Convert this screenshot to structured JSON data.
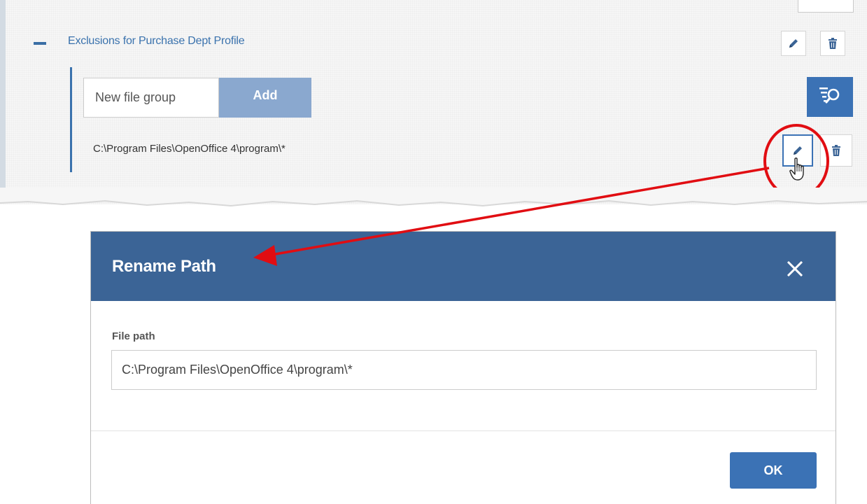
{
  "exclusions": {
    "title": "Exclusions for Purchase Dept Profile",
    "new_file_group_placeholder": "New file group",
    "add_label": "Add",
    "path": "C:\\Program Files\\OpenOffice 4\\program\\*"
  },
  "dialog": {
    "title": "Rename Path",
    "close_symbol": "✕",
    "field_label": "File path",
    "field_value": "C:\\Program Files\\OpenOffice 4\\program\\*",
    "ok_label": "OK"
  },
  "icons": {
    "collapse": "minus-icon",
    "edit": "pencil-icon",
    "delete": "trash-icon",
    "search": "filter-search-icon",
    "cursor": "hand-pointer-icon"
  },
  "colors": {
    "accent": "#3b72b5",
    "link": "#3a72ad",
    "dialog_header": "#3b6496",
    "add_button": "#8aa8cf",
    "annotation": "#e10d12"
  }
}
